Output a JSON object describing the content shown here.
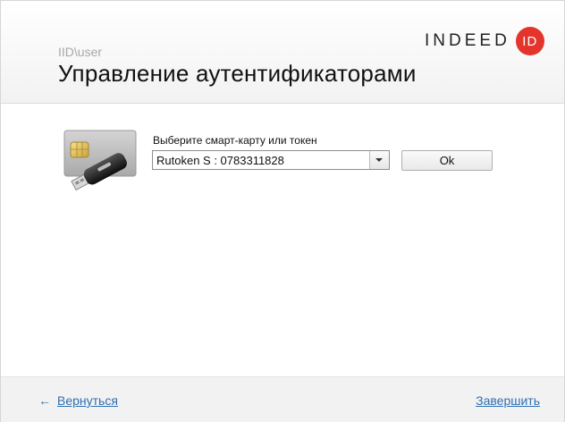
{
  "header": {
    "user_path": "IID\\user",
    "title": "Управление аутентификаторами",
    "logo": {
      "text": "INDEED",
      "badge": "ID",
      "badge_color": "#e3352b"
    }
  },
  "main": {
    "select_label": "Выберите смарт-карту или токен",
    "token_select": {
      "selected": "Rutoken S : 0783311828"
    },
    "ok_label": "Ok",
    "image_icon": "smartcard-usb-token-icon"
  },
  "footer": {
    "back_label": "Вернуться",
    "back_icon": "arrow-left-icon",
    "finish_label": "Завершить",
    "link_color": "#2f6fb3"
  }
}
